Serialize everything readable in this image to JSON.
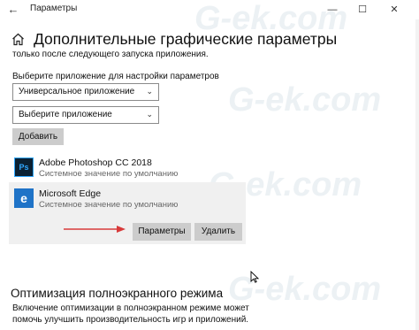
{
  "window": {
    "title": "Параметры",
    "back_icon": "back-arrow-icon",
    "controls": [
      "minimize-icon",
      "maximize-icon",
      "close-icon"
    ]
  },
  "page": {
    "title": "Дополнительные графические параметры",
    "subtext": "только после следующего запуска приложения."
  },
  "selector": {
    "label": "Выберите приложение для настройки параметров",
    "app_type": "Универсальное приложение",
    "app_select": "Выберите приложение",
    "add_label": "Добавить"
  },
  "apps": [
    {
      "name": "Adobe Photoshop CC 2018",
      "status": "Системное значение по умолчанию",
      "icon": "photoshop-icon",
      "icon_text": "Ps"
    },
    {
      "name": "Microsoft Edge",
      "status": "Системное значение по умолчанию",
      "icon": "edge-icon",
      "icon_text": "e",
      "selected": true,
      "actions": {
        "params_label": "Параметры",
        "delete_label": "Удалить"
      }
    }
  ],
  "fullscreen": {
    "heading": "Оптимизация полноэкранного режима",
    "text": "Включение оптимизации в полноэкранном режиме может помочь улучшить производительность игр и приложений."
  },
  "watermark": "G-ek.com",
  "colors": {
    "button_bg": "#cccccc",
    "selected_bg": "#f0f0f0",
    "arrow": "#d83a3a",
    "edge_blue": "#1f73c7"
  }
}
